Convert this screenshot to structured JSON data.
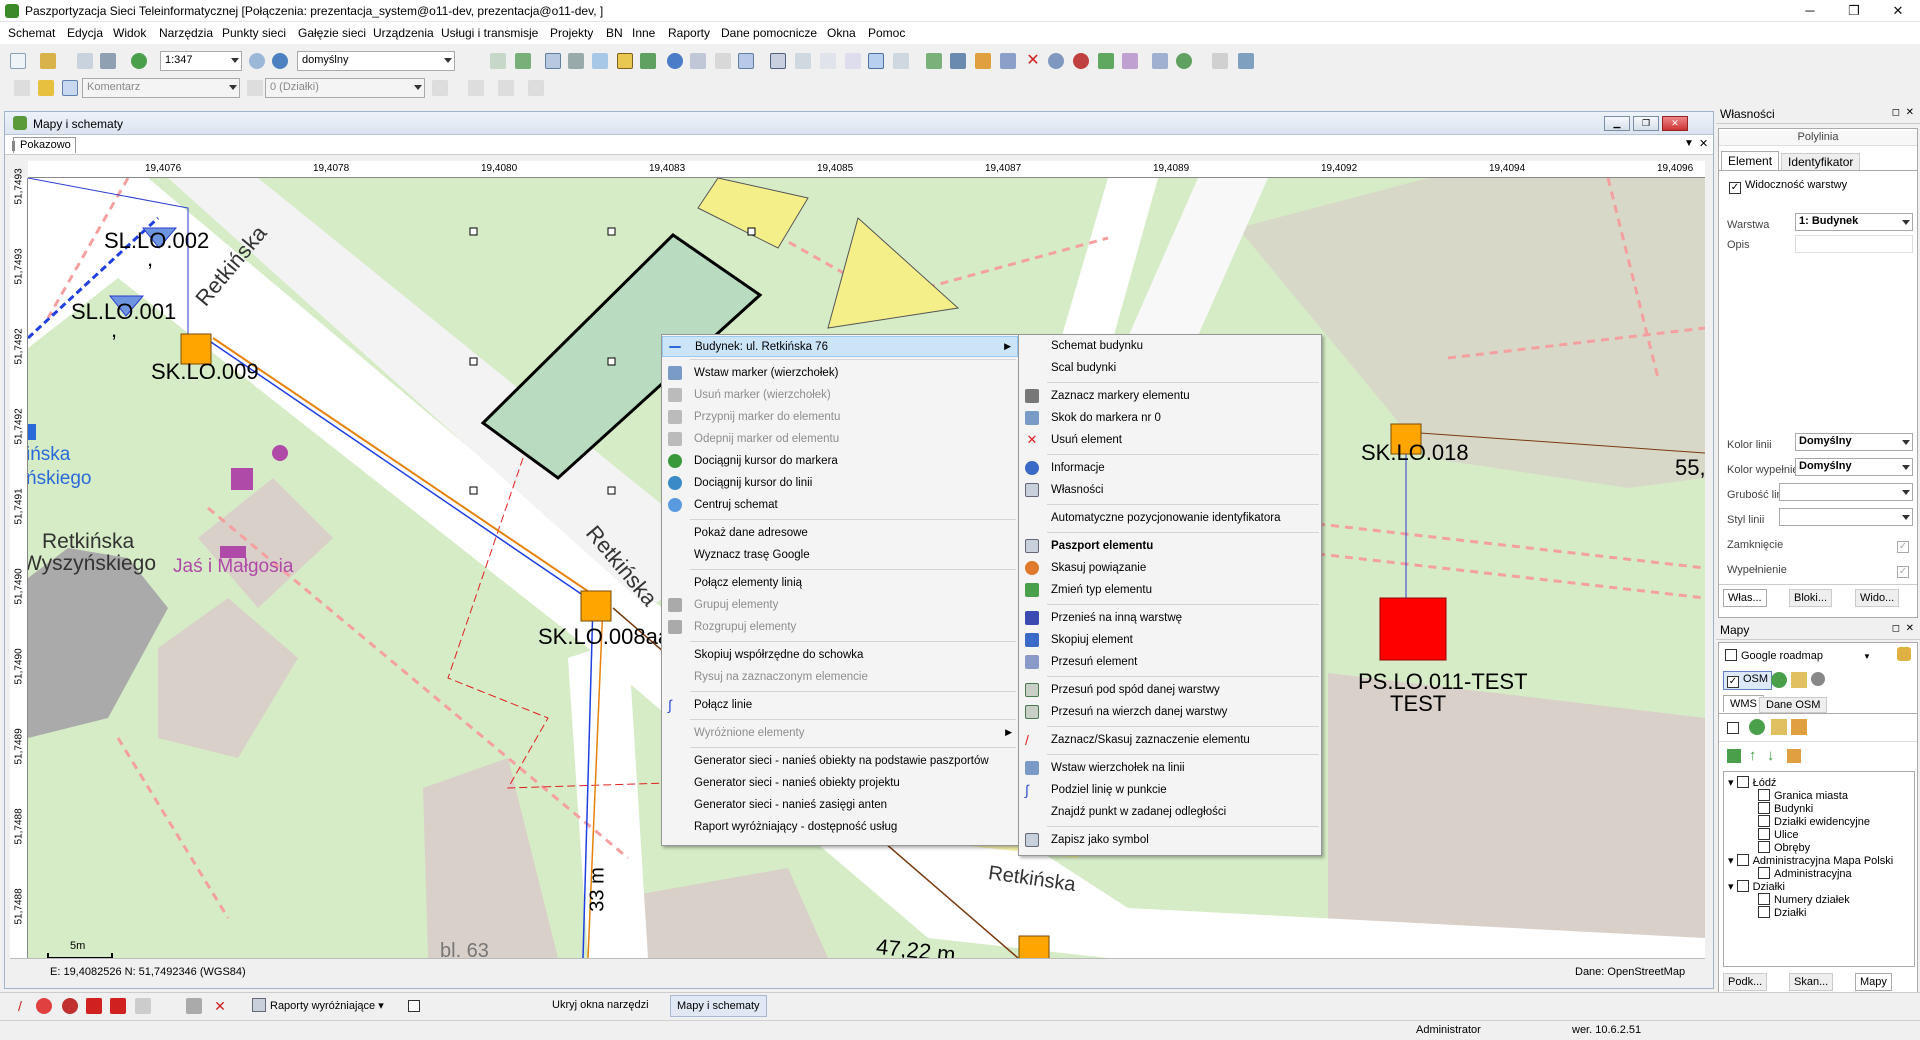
{
  "window": {
    "title": "Paszportyzacja Sieci Teleinformatycznej [Połączenia: prezentacja_system@o11-dev, prezentacja@o11-dev, ]",
    "min": "─",
    "max": "❐",
    "close": "✕"
  },
  "menu": [
    "Schemat",
    "Edycja",
    "Widok",
    "Narzędzia",
    "Punkty sieci",
    "Gałęzie sieci",
    "Urządzenia",
    "Usługi i transmisje",
    "Projekty",
    "BN",
    "Inne",
    "Raporty",
    "Dane pomocnicze",
    "Okna",
    "Pomoc"
  ],
  "toolbar": {
    "scale": "1:347",
    "style": "domyślny",
    "comment": "Komentarz",
    "parcels": "0 (Działki)"
  },
  "mdi": {
    "title": "Mapy i schematy",
    "tab": "Pokazowo"
  },
  "ruler": {
    "top": [
      "19,4076",
      "19,4078",
      "19,4080",
      "19,4083",
      "19,4085",
      "19,4087",
      "19,4089",
      "19,4092",
      "19,4094",
      "19,4096"
    ],
    "left": [
      "51,7493",
      "51,7493",
      "51,7492",
      "51,7492",
      "51,7491",
      "51,7490",
      "51,7490",
      "51,7489",
      "51,7488",
      "51,7488"
    ]
  },
  "map": {
    "labels": {
      "sl002": "SL.LO.002",
      "sl001": "SL.LO.001",
      "sk009": "SK.LO.009",
      "sk008": "SK.LO.008aa",
      "sk018": "SK.LO.018",
      "ps011a": "PS.LO.011-TEST",
      "ps011b": "TEST",
      "dist55": "55,",
      "dist47": "47,22 m",
      "dist33": "33 m",
      "retk1": "Retkińska",
      "retk2": "Retkińska",
      "retk3": "Retkińska",
      "area1": "Retkińska",
      "area2": "Wyszyńskiego",
      "shop": "Jaś i Małgosia",
      "cut1": "ińska",
      "cut2": "ńskiego",
      "bl": "bl. 63",
      "comma1": ",",
      "comma2": ","
    },
    "scalebar": "5m",
    "coords": "E: 19,4082526  N: 51,7492346 (WGS84)",
    "source": "Dane: OpenStreetMap"
  },
  "ctx1": {
    "header": "Budynek: ul. Retkińska 76",
    "items": [
      {
        "label": "Wstaw marker (wierzchołek)",
        "dis": false
      },
      {
        "label": "Usuń marker (wierzchołek)",
        "dis": true
      },
      {
        "label": "Przypnij marker do elementu",
        "dis": true
      },
      {
        "label": "Odepnij marker od elementu",
        "dis": true
      },
      {
        "label": "Dociągnij kursor do markera",
        "dis": false
      },
      {
        "label": "Dociągnij kursor do linii",
        "dis": false
      },
      {
        "label": "Centruj schemat",
        "dis": false
      },
      {
        "label": "Pokaż dane adresowe",
        "dis": false
      },
      {
        "label": "Wyznacz trasę Google",
        "dis": false
      },
      {
        "label": "Połącz elementy linią",
        "dis": false
      },
      {
        "label": "Grupuj elementy",
        "dis": true
      },
      {
        "label": "Rozgrupuj elementy",
        "dis": true
      },
      {
        "label": "Skopiuj współrzędne do schowka",
        "dis": false
      },
      {
        "label": "Rysuj na zaznaczonym elemencie",
        "dis": true
      },
      {
        "label": "Połącz linie",
        "dis": false
      },
      {
        "label": "Wyróżnione elementy",
        "dis": true
      },
      {
        "label": "Generator sieci - nanieś obiekty na podstawie paszportów",
        "dis": false
      },
      {
        "label": "Generator sieci - nanieś obiekty projektu",
        "dis": false
      },
      {
        "label": "Generator sieci - nanieś zasięgi anten",
        "dis": false
      },
      {
        "label": "Raport wyróżniający - dostępność usług",
        "dis": false
      }
    ]
  },
  "ctx2": {
    "items": [
      {
        "label": "Schemat budynku"
      },
      {
        "label": "Scal budynki"
      },
      {
        "label": "Zaznacz markery elementu"
      },
      {
        "label": "Skok do markera nr 0"
      },
      {
        "label": "Usuń element"
      },
      {
        "label": "Informacje"
      },
      {
        "label": "Własności"
      },
      {
        "label": "Automatyczne pozycjonowanie identyfikatora"
      },
      {
        "label": "Paszport elementu"
      },
      {
        "label": "Skasuj powiązanie"
      },
      {
        "label": "Zmień typ elementu"
      },
      {
        "label": "Przenieś na inną warstwę"
      },
      {
        "label": "Skopiuj element"
      },
      {
        "label": "Przesuń element"
      },
      {
        "label": "Przesuń pod spód danej warstwy"
      },
      {
        "label": "Przesuń na wierzch danej warstwy"
      },
      {
        "label": "Zaznacz/Skasuj zaznaczenie elementu"
      },
      {
        "label": "Wstaw wierzchołek na linii"
      },
      {
        "label": "Podziel linię w punkcie"
      },
      {
        "label": "Znajdź punkt w zadanej odległości"
      },
      {
        "label": "Zapisz jako symbol"
      }
    ]
  },
  "props": {
    "title": "Własności",
    "type": "Polylinia",
    "tab1": "Element",
    "tab2": "Identyfikator",
    "visibility": "Widoczność warstwy",
    "layer_label": "Warstwa",
    "layer_value": "1: Budynek",
    "desc_label": "Opis",
    "line_color_label": "Kolor linii",
    "line_color_value": "Domyślny",
    "fill_color_label": "Kolor wypełnienia",
    "fill_color_value": "Domyślny",
    "line_width_label": "Grubość linii",
    "line_style_label": "Styl linii",
    "closing_label": "Zamknięcie",
    "fill_label": "Wypełnienie",
    "bottom_tabs": [
      "Włas...",
      "Bloki...",
      "Wido..."
    ]
  },
  "maps": {
    "title": "Mapy",
    "google": "Google  roadmap",
    "osm": "OSM",
    "tab1": "WMS",
    "tab2": "Dane OSM",
    "tree": [
      {
        "label": "Łódź",
        "level": 0,
        "exp": true
      },
      {
        "label": "Granica miasta",
        "level": 1
      },
      {
        "label": "Budynki",
        "level": 1
      },
      {
        "label": "Działki ewidencyjne",
        "level": 1
      },
      {
        "label": "Ulice",
        "level": 1
      },
      {
        "label": "Obręby",
        "level": 1
      },
      {
        "label": "Administracyjna Mapa Polski",
        "level": 0,
        "exp": true
      },
      {
        "label": "Administracyjna",
        "level": 1
      },
      {
        "label": "Działki",
        "level": 0,
        "exp": true
      },
      {
        "label": "Numery działek",
        "level": 1
      },
      {
        "label": "Działki",
        "level": 1
      }
    ],
    "bottom_tabs": [
      "Podk...",
      "Skan...",
      "Mapy"
    ]
  },
  "bottom": {
    "reports": "Raporty wyróżniające",
    "hide": "Ukryj okna narzędzi",
    "maps": "Mapy i schematy"
  },
  "status": {
    "user": "Administrator",
    "version": "wer. 10.6.2.51"
  },
  "colors": {
    "green_bg": "#d6ecc6",
    "road": "#ffffff",
    "building": "#d9d0c9",
    "selected_building": "#b9dcc0",
    "node": "#ffa500",
    "ps_node": "#ff0000",
    "highlight": "#cce4f7"
  }
}
